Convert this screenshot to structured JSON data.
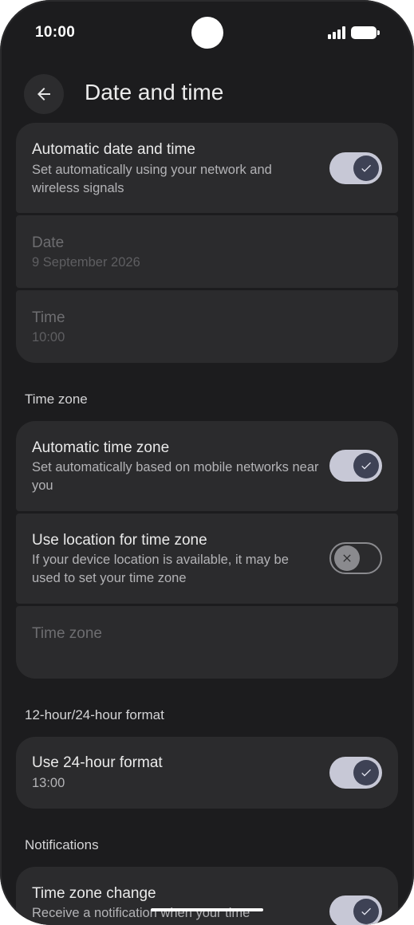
{
  "status_bar": {
    "time": "10:00"
  },
  "header": {
    "title": "Date and time"
  },
  "auto_date_time": {
    "title": "Automatic date and time",
    "subtitle": "Set automatically using your network and wireless signals",
    "enabled": true
  },
  "date": {
    "title": "Date",
    "value": "9 September 2026"
  },
  "time": {
    "title": "Time",
    "value": "10:00"
  },
  "section_time_zone": "Time zone",
  "auto_time_zone": {
    "title": "Automatic time zone",
    "subtitle": "Set automatically based on mobile networks near you",
    "enabled": true
  },
  "location_time_zone": {
    "title": "Use location for time zone",
    "subtitle": "If your device location is available, it may be used to set your time zone",
    "enabled": false
  },
  "time_zone_item": {
    "title": "Time zone"
  },
  "section_format": "12-hour/24-hour format",
  "format_24h": {
    "title": "Use 24-hour format",
    "subtitle": "13:00",
    "enabled": true
  },
  "section_notifications": "Notifications",
  "tz_change": {
    "title": "Time zone change",
    "subtitle": "Receive a notification when your time",
    "enabled": true
  },
  "colors": {
    "background": "#1c1c1e",
    "card": "#2b2b2d",
    "switch_on_track": "#c7c8d6",
    "switch_on_thumb": "#3e4255"
  }
}
